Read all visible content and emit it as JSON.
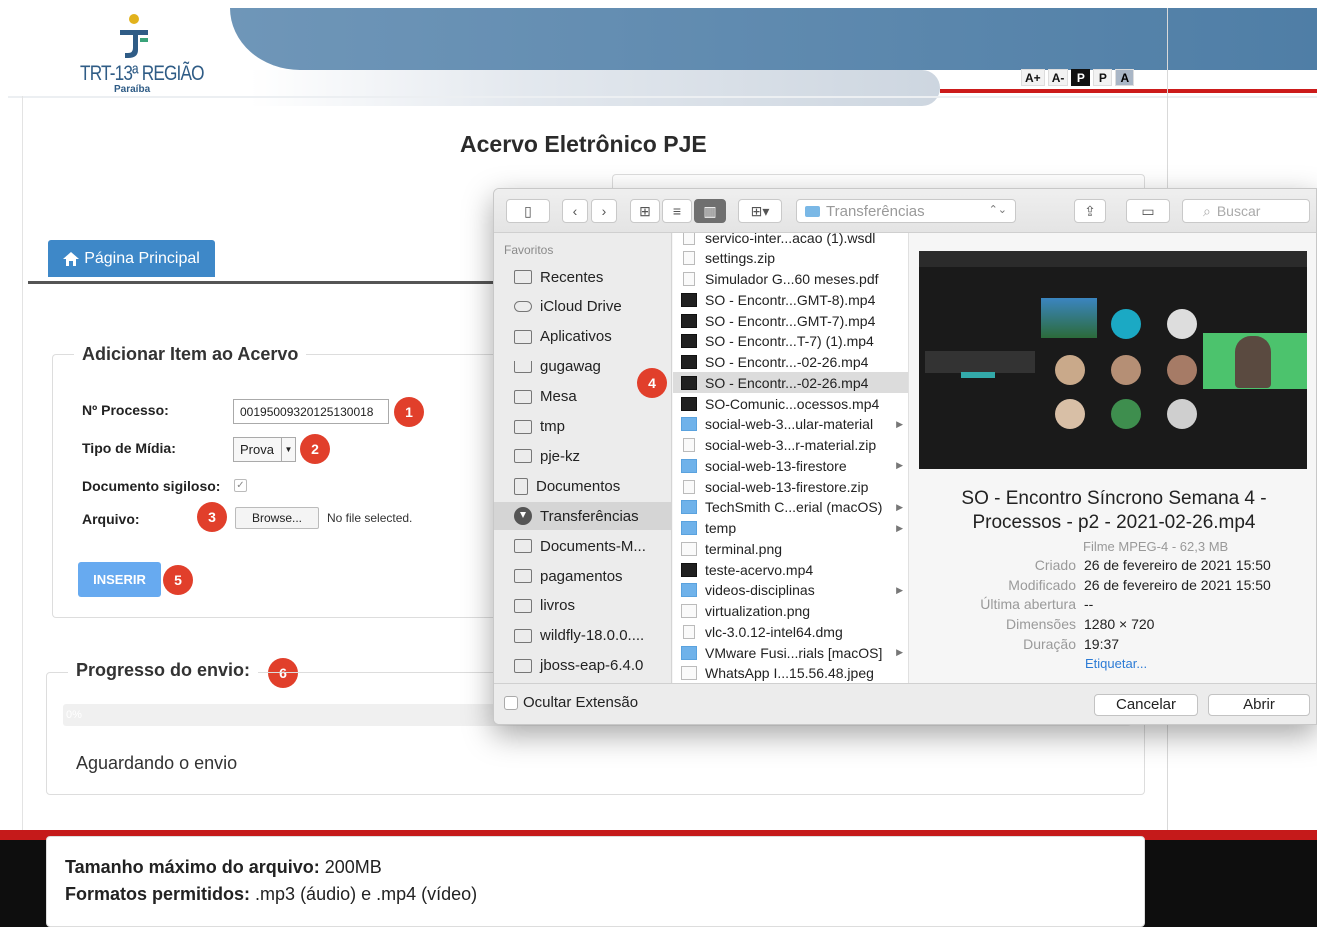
{
  "header": {
    "logo_text": "TRT-13ª REGIÃO",
    "logo_sub": "Paraíba",
    "font_controls": [
      "A+",
      "A-",
      "P",
      "P",
      "A"
    ]
  },
  "page_title": "Acervo Eletrônico PJE",
  "home_button": "Página Principal",
  "form": {
    "legend": "Adicionar Item ao Acervo",
    "processo_label": "Nº Processo:",
    "processo_value": "00195009320125130018",
    "midia_label": "Tipo de Mídia:",
    "midia_value": "Prova",
    "sigiloso_label": "Documento sigiloso:",
    "sigiloso_checked": true,
    "arquivo_label": "Arquivo:",
    "browse_label": "Browse...",
    "no_file": "No file selected.",
    "insert_label": "INSERIR"
  },
  "progress": {
    "legend": "Progresso do envio:",
    "percent_label": "0%",
    "value": 0,
    "status": "Aguardando o envio"
  },
  "info": {
    "size_label": "Tamanho máximo do arquivo:",
    "size_value": "200MB",
    "formats_label": "Formatos permitidos:",
    "formats_value": ".mp3 (áudio) e .mp4 (vídeo)"
  },
  "badges": [
    "1",
    "2",
    "3",
    "4",
    "5",
    "6"
  ],
  "dialog": {
    "location": "Transferências",
    "search_placeholder": "Buscar",
    "sidebar_heading": "Favoritos",
    "sidebar_items": [
      {
        "label": "Recentes",
        "icon": "clock-icon"
      },
      {
        "label": "iCloud Drive",
        "icon": "cloud-icon"
      },
      {
        "label": "Aplicativos",
        "icon": "apps-icon"
      },
      {
        "label": "gugawag",
        "icon": "home-icon"
      },
      {
        "label": "Mesa",
        "icon": "desktop-icon"
      },
      {
        "label": "tmp",
        "icon": "folder-icon"
      },
      {
        "label": "pje-kz",
        "icon": "folder-icon"
      },
      {
        "label": "Documentos",
        "icon": "document-icon"
      },
      {
        "label": "Transferências",
        "icon": "download-icon",
        "active": true
      },
      {
        "label": "Documents-M...",
        "icon": "folder-icon"
      },
      {
        "label": "pagamentos",
        "icon": "folder-icon"
      },
      {
        "label": "livros",
        "icon": "folder-icon"
      },
      {
        "label": "wildfly-18.0.0....",
        "icon": "folder-icon"
      },
      {
        "label": "jboss-eap-6.4.0",
        "icon": "folder-icon"
      }
    ],
    "files": [
      {
        "name": "servico-inter...acao (1).wsdl",
        "kind": "doc"
      },
      {
        "name": "settings.zip",
        "kind": "doc"
      },
      {
        "name": "Simulador G...60 meses.pdf",
        "kind": "doc"
      },
      {
        "name": "SO - Encontr...GMT-8).mp4",
        "kind": "video"
      },
      {
        "name": "SO - Encontr...GMT-7).mp4",
        "kind": "video"
      },
      {
        "name": "SO - Encontr...T-7) (1).mp4",
        "kind": "video"
      },
      {
        "name": "SO - Encontr...-02-26.mp4",
        "kind": "video"
      },
      {
        "name": "SO - Encontr...-02-26.mp4",
        "kind": "video",
        "selected": true
      },
      {
        "name": "SO-Comunic...ocessos.mp4",
        "kind": "video"
      },
      {
        "name": "social-web-3...ular-material",
        "kind": "folder",
        "chevron": true
      },
      {
        "name": "social-web-3...r-material.zip",
        "kind": "doc"
      },
      {
        "name": "social-web-13-firestore",
        "kind": "folder",
        "chevron": true
      },
      {
        "name": "social-web-13-firestore.zip",
        "kind": "doc"
      },
      {
        "name": "TechSmith C...erial (macOS)",
        "kind": "folder",
        "chevron": true
      },
      {
        "name": "temp",
        "kind": "folder",
        "chevron": true
      },
      {
        "name": "terminal.png",
        "kind": "image"
      },
      {
        "name": "teste-acervo.mp4",
        "kind": "video"
      },
      {
        "name": "videos-disciplinas",
        "kind": "folder",
        "chevron": true
      },
      {
        "name": "virtualization.png",
        "kind": "image"
      },
      {
        "name": "vlc-3.0.12-intel64.dmg",
        "kind": "doc"
      },
      {
        "name": "VMware Fusi...rials [macOS]",
        "kind": "folder",
        "chevron": true
      },
      {
        "name": "WhatsApp I...15.56.48.jpeg",
        "kind": "image"
      }
    ],
    "preview": {
      "title": "SO - Encontro Síncrono Semana 4 - Processos - p2 - 2021-02-26.mp4",
      "kind": "Filme MPEG-4 - 62,3 MB",
      "meta": [
        {
          "key": "Criado",
          "value": "26 de fevereiro de 2021 15:50"
        },
        {
          "key": "Modificado",
          "value": "26 de fevereiro de 2021 15:50"
        },
        {
          "key": "Última abertura",
          "value": "--"
        },
        {
          "key": "Dimensões",
          "value": "1280 × 720"
        },
        {
          "key": "Duração",
          "value": "19:37"
        }
      ],
      "tag_link": "Etiquetar..."
    },
    "hide_extension": "Ocultar Extensão",
    "cancel": "Cancelar",
    "open": "Abrir"
  }
}
